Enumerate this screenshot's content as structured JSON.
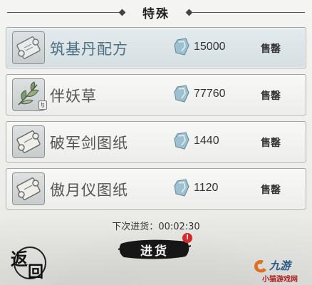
{
  "header": {
    "title": "特殊"
  },
  "items": [
    {
      "name": "筑基丹配方",
      "price": "15000",
      "action": "售罄",
      "icon": "scroll-recipe-icon",
      "highlight": true
    },
    {
      "name": "伴妖草",
      "price": "77760",
      "action": "售罄",
      "icon": "herb-leaf-icon",
      "highlight": false
    },
    {
      "name": "破军剑图纸",
      "price": "1440",
      "action": "售罄",
      "icon": "scroll-blueprint-icon",
      "highlight": false
    },
    {
      "name": "傲月仪图纸",
      "price": "1120",
      "action": "售罄",
      "icon": "scroll-blueprint-icon",
      "highlight": false
    }
  ],
  "currency_icon": "spirit-stone-icon",
  "restock": {
    "label": "下次进货：",
    "time": "00:02:30",
    "button_label": "进货",
    "alert": "!"
  },
  "back_button": {
    "char1": "返",
    "char2": "回"
  },
  "watermark": {
    "brand": "九游",
    "site": "小猫游戏网"
  },
  "colors": {
    "highlight_name": "#4d6f80",
    "alert": "#d52a2a",
    "gem": "#7fa6b8"
  }
}
